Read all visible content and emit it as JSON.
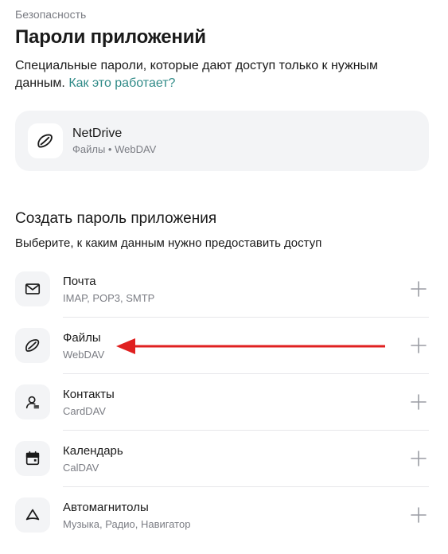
{
  "header": {
    "breadcrumb": "Безопасность",
    "title": "Пароли приложений",
    "description": "Специальные пароли, которые дают доступ только к нужным данным.",
    "link": "Как это работает?"
  },
  "existing_password": {
    "title": "NetDrive",
    "subtitle": "Файлы • WebDAV",
    "icon": "disk-icon"
  },
  "create": {
    "title": "Создать пароль приложения",
    "subtitle": "Выберите, к каким данным нужно предоставить доступ",
    "items": [
      {
        "label": "Почта",
        "sub": "IMAP, POP3, SMTP",
        "icon": "mail-icon"
      },
      {
        "label": "Файлы",
        "sub": "WebDAV",
        "icon": "disk-icon"
      },
      {
        "label": "Контакты",
        "sub": "CardDAV",
        "icon": "contacts-icon"
      },
      {
        "label": "Календарь",
        "sub": "CalDAV",
        "icon": "calendar-icon"
      },
      {
        "label": "Автомагнитолы",
        "sub": "Музыка, Радио, Навигатор",
        "icon": "car-radio-icon"
      }
    ]
  },
  "colors": {
    "accent_link": "#2f8a87",
    "annotation_arrow": "#e02020",
    "card_bg": "#f3f4f6"
  }
}
